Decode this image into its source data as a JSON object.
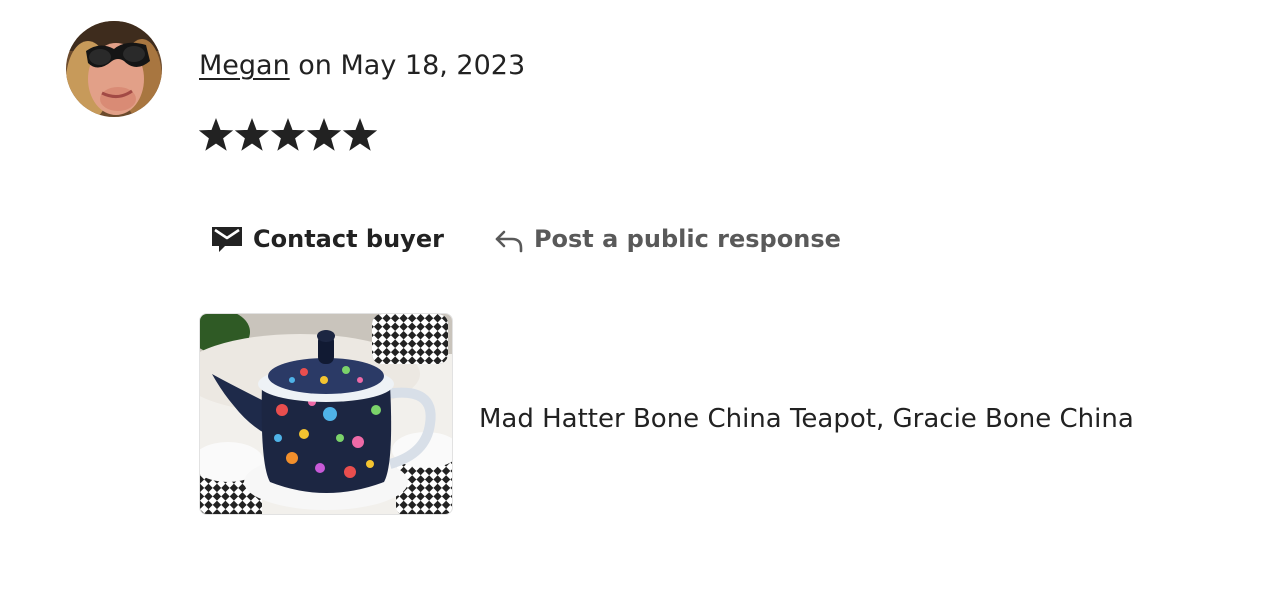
{
  "review": {
    "reviewer_name": "Megan",
    "date_prefix": " on ",
    "date": "May 18, 2023",
    "rating": 5,
    "rating_max": 5
  },
  "actions": {
    "contact_label": "Contact buyer",
    "respond_label": "Post a public response"
  },
  "listing": {
    "title": "Mad Hatter Bone China Teapot, Gracie Bone China"
  },
  "icons": {
    "contact": "mail-icon",
    "respond": "reply-arrow-icon",
    "star": "star-icon"
  },
  "colors": {
    "text": "#222222",
    "muted": "#595959",
    "star": "#222222"
  }
}
